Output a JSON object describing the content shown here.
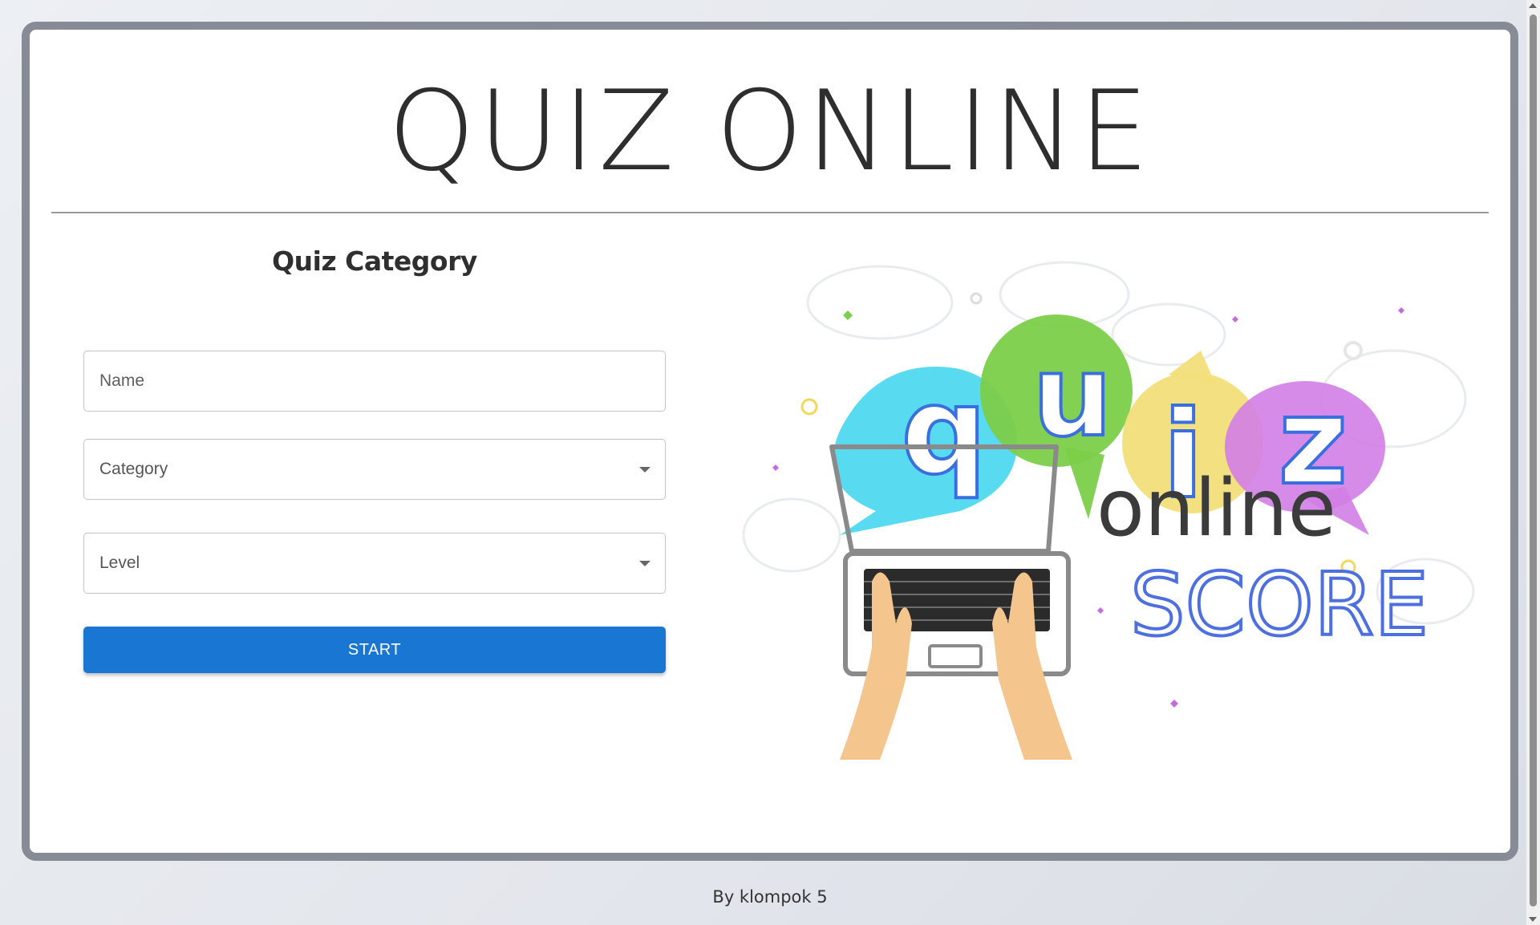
{
  "app": {
    "title": "QUIZ ONLINE"
  },
  "form": {
    "heading": "Quiz Category",
    "name_placeholder": "Name",
    "category_label": "Category",
    "level_label": "Level",
    "start_label": "START"
  },
  "illustration": {
    "letters": [
      "q",
      "u",
      "i",
      "z"
    ],
    "online_text": "online",
    "score_text": "SCORE"
  },
  "footer": {
    "text": "By klompok 5"
  },
  "colors": {
    "primary": "#1976d2",
    "card_border": "#868b96",
    "bubble_cyan": "#4fd8ef",
    "bubble_green": "#7ccf4a",
    "bubble_yellow": "#f2de7a",
    "bubble_purple": "#d27ee6",
    "score_blue": "#4d6fe0"
  }
}
